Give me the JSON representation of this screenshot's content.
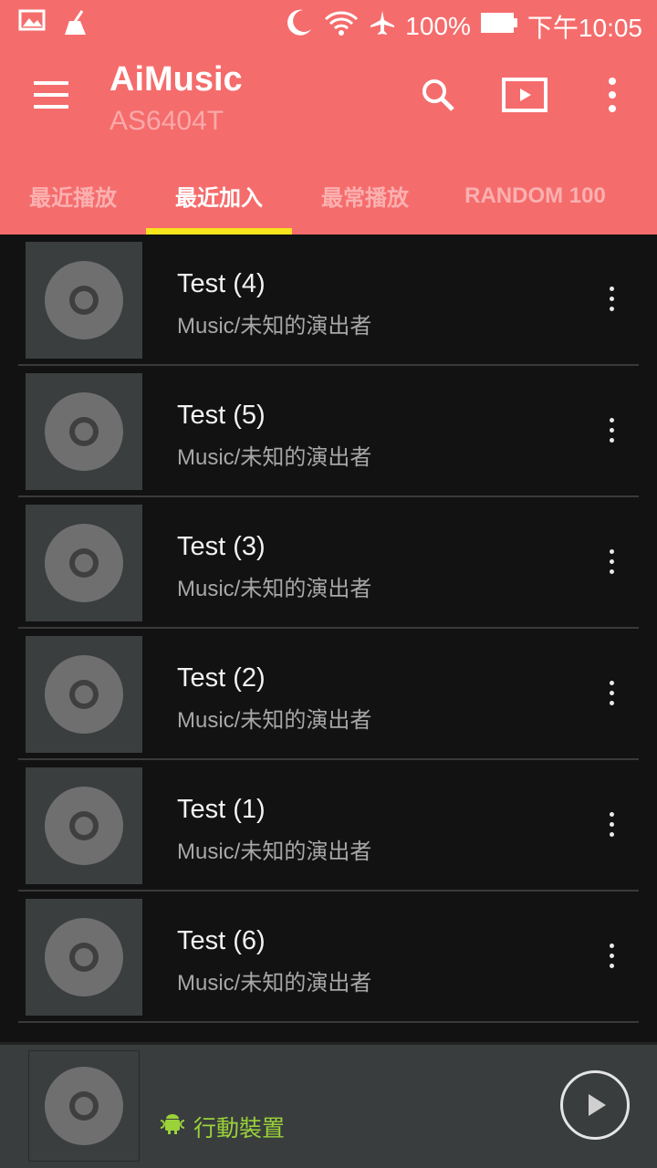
{
  "status_bar": {
    "battery": "100%",
    "time": "下午10:05",
    "icons": [
      "image-icon",
      "cleaner-icon",
      "moon-icon",
      "wifi-icon",
      "airplane-icon",
      "battery-icon"
    ]
  },
  "app_bar": {
    "title": "AiMusic",
    "subtitle": "AS6404T",
    "icons": [
      "menu-icon",
      "search-icon",
      "cast-icon",
      "more-vert-icon"
    ]
  },
  "tabs": [
    {
      "label": "最近播放",
      "active": false
    },
    {
      "label": "最近加入",
      "active": true
    },
    {
      "label": "最常播放",
      "active": false
    },
    {
      "label": "RANDOM 100",
      "active": false
    }
  ],
  "colors": {
    "header": "#f56c6c",
    "tab_indicator": "#f8e41c",
    "device_label": "#9ad23a",
    "background": "#121212"
  },
  "songs": [
    {
      "title": "Test (4)",
      "subtitle": "Music/未知的演出者"
    },
    {
      "title": "Test (5)",
      "subtitle": "Music/未知的演出者"
    },
    {
      "title": "Test (3)",
      "subtitle": "Music/未知的演出者"
    },
    {
      "title": "Test (2)",
      "subtitle": "Music/未知的演出者"
    },
    {
      "title": "Test (1)",
      "subtitle": "Music/未知的演出者"
    },
    {
      "title": "Test (6)",
      "subtitle": "Music/未知的演出者"
    }
  ],
  "player": {
    "device_label": "行動裝置",
    "icons": [
      "android-icon",
      "play-icon"
    ]
  }
}
